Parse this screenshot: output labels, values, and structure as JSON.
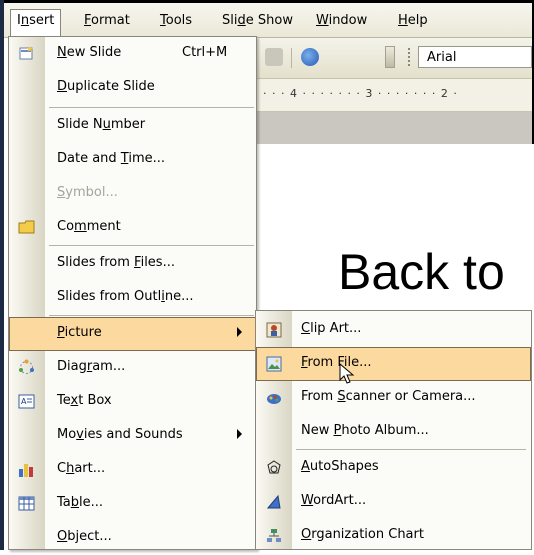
{
  "menubar": {
    "items": [
      {
        "pre": "I",
        "u": "n",
        "post": "sert"
      },
      {
        "pre": "",
        "u": "F",
        "post": "ormat"
      },
      {
        "pre": "",
        "u": "T",
        "post": "ools"
      },
      {
        "pre": "Sli",
        "u": "d",
        "post": "e Show"
      },
      {
        "pre": "",
        "u": "W",
        "post": "indow"
      },
      {
        "pre": "",
        "u": "H",
        "post": "elp"
      }
    ]
  },
  "toolbar": {
    "font_name": "Arial"
  },
  "ruler": {
    "text": "· · · 4 · · · · · · · 3 · · · · · · · 2 ·"
  },
  "slide": {
    "title_text": "Back to"
  },
  "insert_menu": {
    "new_slide": {
      "pre": "",
      "u": "N",
      "post": "ew Slide",
      "shortcut": "Ctrl+M"
    },
    "duplicate_slide": {
      "pre": "",
      "u": "D",
      "post": "uplicate Slide"
    },
    "slide_number": {
      "pre": "Slide N",
      "u": "u",
      "post": "mber"
    },
    "date_time": {
      "pre": "Date and ",
      "u": "T",
      "post": "ime..."
    },
    "symbol": {
      "pre": "",
      "u": "S",
      "post": "ymbol..."
    },
    "comment": {
      "pre": "Co",
      "u": "m",
      "post": "ment"
    },
    "slides_files": {
      "pre": "Slides from ",
      "u": "F",
      "post": "iles..."
    },
    "slides_outline": {
      "pre": "Slides from Outl",
      "u": "i",
      "post": "ne..."
    },
    "picture": {
      "pre": "",
      "u": "P",
      "post": "icture"
    },
    "diagram": {
      "pre": "Diag",
      "u": "r",
      "post": "am..."
    },
    "text_box": {
      "pre": "Te",
      "u": "x",
      "post": "t Box"
    },
    "movies_sounds": {
      "pre": "Mo",
      "u": "v",
      "post": "ies and Sounds"
    },
    "chart": {
      "pre": "C",
      "u": "h",
      "post": "art..."
    },
    "table": {
      "pre": "Ta",
      "u": "b",
      "post": "le..."
    },
    "object": {
      "pre": "",
      "u": "O",
      "post": "bject..."
    }
  },
  "picture_submenu": {
    "clip_art": {
      "pre": "",
      "u": "C",
      "post": "lip Art..."
    },
    "from_file": {
      "pre": "",
      "u": "F",
      "post": "rom File..."
    },
    "from_scanner": {
      "pre": "From ",
      "u": "S",
      "post": "canner or Camera..."
    },
    "new_photo_album": {
      "pre": "New ",
      "u": "P",
      "post": "hoto Album..."
    },
    "autoshapes": {
      "pre": "",
      "u": "A",
      "post": "utoShapes"
    },
    "wordart": {
      "pre": "",
      "u": "W",
      "post": "ordArt..."
    },
    "org_chart": {
      "pre": "",
      "u": "O",
      "post": "rganization Chart"
    }
  },
  "colors": {
    "highlight": "#fcd99e",
    "highlight_border": "#7d6b4f",
    "disabled_text": "#a6a49a"
  }
}
